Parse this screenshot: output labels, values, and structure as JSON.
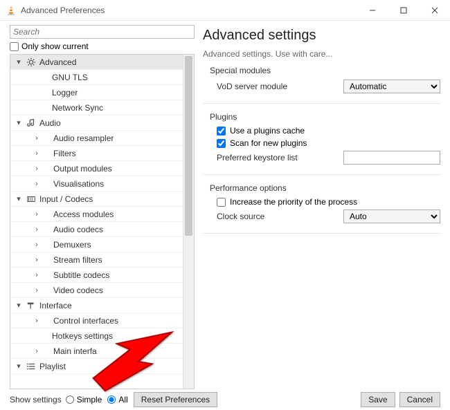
{
  "window": {
    "title": "Advanced Preferences"
  },
  "search": {
    "placeholder": "Search"
  },
  "only_show_current": "Only show current",
  "tree": [
    {
      "level": 1,
      "exp": "v",
      "icon": "gear",
      "label": "Advanced",
      "selected": true
    },
    {
      "level": 2,
      "exp": "",
      "icon": "",
      "label": "GNU TLS",
      "child": true
    },
    {
      "level": 2,
      "exp": "",
      "icon": "",
      "label": "Logger",
      "child": true
    },
    {
      "level": 2,
      "exp": "",
      "icon": "",
      "label": "Network Sync",
      "child": true
    },
    {
      "level": 1,
      "exp": "v",
      "icon": "note",
      "label": "Audio"
    },
    {
      "level": 2,
      "exp": ">",
      "icon": "",
      "label": "Audio resampler"
    },
    {
      "level": 2,
      "exp": ">",
      "icon": "",
      "label": "Filters"
    },
    {
      "level": 2,
      "exp": ">",
      "icon": "",
      "label": "Output modules"
    },
    {
      "level": 2,
      "exp": ">",
      "icon": "",
      "label": "Visualisations"
    },
    {
      "level": 1,
      "exp": "v",
      "icon": "codec",
      "label": "Input / Codecs"
    },
    {
      "level": 2,
      "exp": ">",
      "icon": "",
      "label": "Access modules"
    },
    {
      "level": 2,
      "exp": ">",
      "icon": "",
      "label": "Audio codecs"
    },
    {
      "level": 2,
      "exp": ">",
      "icon": "",
      "label": "Demuxers"
    },
    {
      "level": 2,
      "exp": ">",
      "icon": "",
      "label": "Stream filters"
    },
    {
      "level": 2,
      "exp": ">",
      "icon": "",
      "label": "Subtitle codecs"
    },
    {
      "level": 2,
      "exp": ">",
      "icon": "",
      "label": "Video codecs"
    },
    {
      "level": 1,
      "exp": "v",
      "icon": "brush",
      "label": "Interface"
    },
    {
      "level": 2,
      "exp": ">",
      "icon": "",
      "label": "Control interfaces"
    },
    {
      "level": 2,
      "exp": "",
      "icon": "",
      "label": "Hotkeys settings",
      "child": true
    },
    {
      "level": 2,
      "exp": ">",
      "icon": "",
      "label": "Main interfa"
    },
    {
      "level": 1,
      "exp": "v",
      "icon": "list",
      "label": "Playlist"
    }
  ],
  "right": {
    "heading": "Advanced settings",
    "subtitle": "Advanced settings. Use with care...",
    "group1": {
      "title": "Special modules",
      "vod_label": "VoD server module",
      "vod_value": "Automatic"
    },
    "group2": {
      "title": "Plugins",
      "use_cache": "Use a plugins cache",
      "scan": "Scan for new plugins",
      "keystore_label": "Preferred keystore list",
      "keystore_value": ""
    },
    "group3": {
      "title": "Performance options",
      "increase": "Increase the priority of the process",
      "clock_label": "Clock source",
      "clock_value": "Auto"
    }
  },
  "bottom": {
    "show_label": "Show settings",
    "simple": "Simple",
    "all": "All",
    "reset": "Reset Preferences",
    "save": "Save",
    "cancel": "Cancel"
  }
}
